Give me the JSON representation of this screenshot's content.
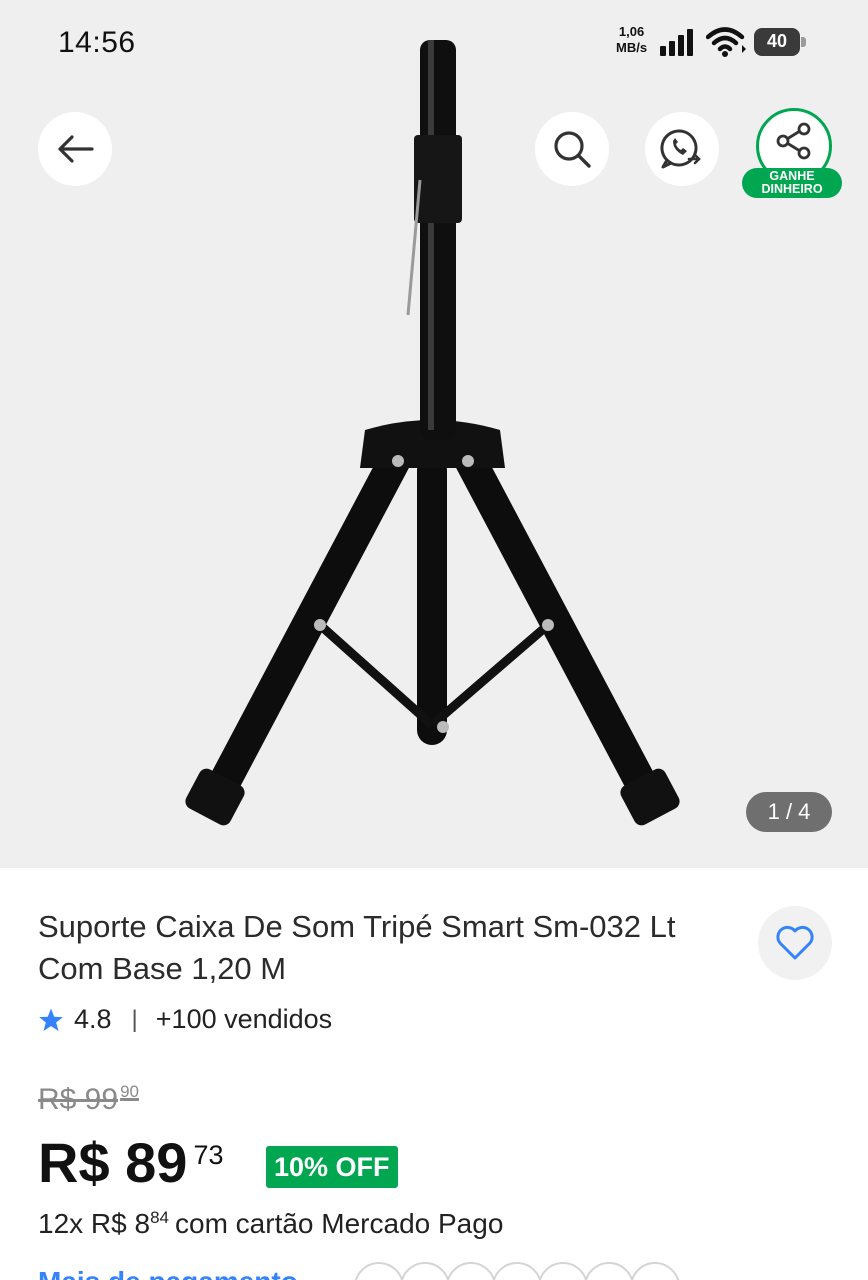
{
  "status_bar": {
    "time": "14:56",
    "net_speed_value": "1,06",
    "net_speed_unit": "MB/s",
    "battery": "40"
  },
  "actions": {
    "earn_label_line1": "GANHE",
    "earn_label_line2": "DINHEIRO",
    "brand_color": "#00a650"
  },
  "gallery": {
    "counter": "1 / 4",
    "background": "#efefef"
  },
  "product": {
    "title": "Suporte Caixa De Som Tripé Smart Sm-032 Lt Com Base 1,20 M",
    "rating": "4.8",
    "rating_separator": "|",
    "sold": "+100 vendidos",
    "old_price_main": "R$ 99",
    "old_price_cents": "90",
    "price_main": "R$ 89",
    "price_cents": "73",
    "discount": "10% OFF",
    "installments_prefix": "12x R$ 8",
    "installments_cents": "84",
    "installments_suffix": "com cartão Mercado Pago",
    "more_link": "Mais de pagamento"
  },
  "icons": [
    "back-arrow-icon",
    "search-icon",
    "whatsapp-icon",
    "share-icon",
    "heart-icon",
    "star-icon"
  ]
}
